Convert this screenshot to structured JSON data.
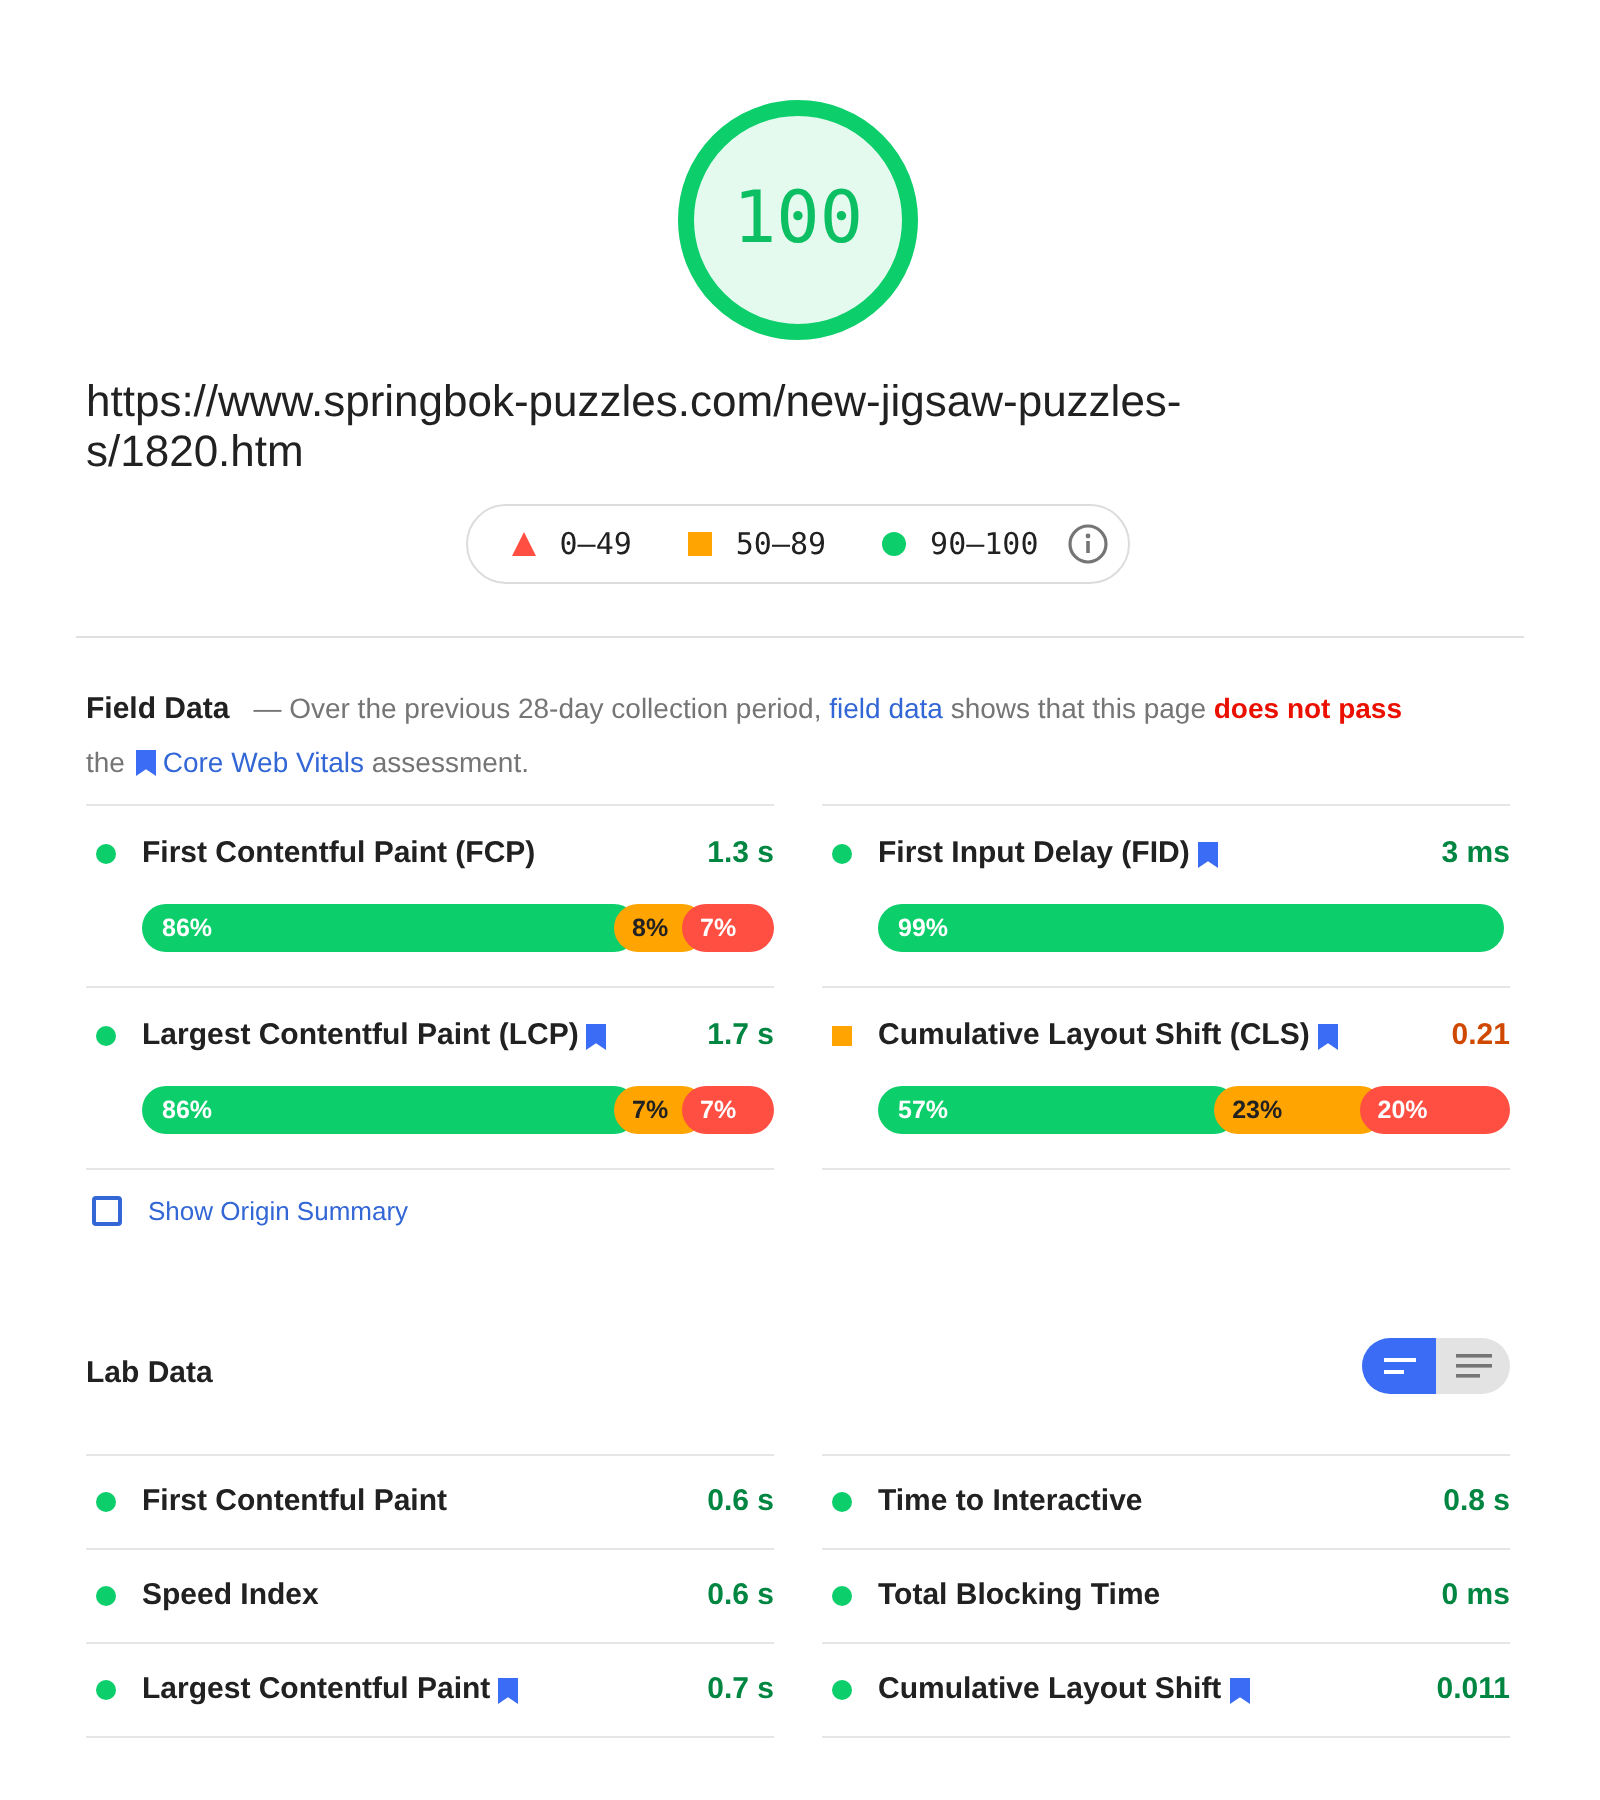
{
  "gauge": {
    "score": "100",
    "level": 1
  },
  "url": "https://www.springbok-puzzles.com/new-jigsaw-puzzles-s/1820.htm",
  "legend": [
    {
      "kind": "fail",
      "label": "0–49"
    },
    {
      "kind": "average",
      "label": "50–89"
    },
    {
      "kind": "pass",
      "label": "90–100"
    }
  ],
  "field_data": {
    "title": "Field Data",
    "description": [
      {
        "kind": "text",
        "text": "— Over the previous 28-day collection period,"
      },
      {
        "kind": "link",
        "text": "field data"
      },
      {
        "kind": "text",
        "text": "shows that this page"
      },
      {
        "kind": "alert",
        "text": "does not pass"
      },
      {
        "kind": "text",
        "text": "the"
      },
      {
        "kind": "cwv_link",
        "text": "Core Web Vitals"
      },
      {
        "kind": "text",
        "text": "assessment."
      }
    ],
    "metrics": [
      {
        "name": "First Contentful Paint (FCP)",
        "core_web_vital": false,
        "value": "1.3 s",
        "kind": "pass",
        "distribution": [
          {
            "kind": "pass",
            "label": "86%"
          },
          {
            "kind": "average",
            "label": "8%"
          },
          {
            "kind": "fail",
            "label": "7%"
          }
        ]
      },
      {
        "name": "First Input Delay (FID)",
        "core_web_vital": true,
        "value": "3 ms",
        "kind": "pass",
        "distribution": [
          {
            "kind": "pass",
            "label": "99%"
          }
        ]
      },
      {
        "name": "Largest Contentful Paint (LCP)",
        "core_web_vital": true,
        "value": "1.7 s",
        "kind": "pass",
        "distribution": [
          {
            "kind": "pass",
            "label": "86%"
          },
          {
            "kind": "average",
            "label": "7%"
          },
          {
            "kind": "fail",
            "label": "7%"
          }
        ]
      },
      {
        "name": "Cumulative Layout Shift (CLS)",
        "core_web_vital": true,
        "value": "0.21",
        "kind": "average",
        "distribution": [
          {
            "kind": "pass",
            "label": "57%"
          },
          {
            "kind": "average",
            "label": "23%"
          },
          {
            "kind": "fail",
            "label": "20%"
          }
        ]
      }
    ],
    "origin_summary": {
      "label": "Show Origin Summary",
      "checked": false
    }
  },
  "lab_data": {
    "title": "Lab Data",
    "view_toggle": [
      {
        "selected": true
      },
      {
        "selected": false
      }
    ],
    "metrics": [
      {
        "name": "First Contentful Paint",
        "core_web_vital": false,
        "value": "0.6 s",
        "kind": "pass"
      },
      {
        "name": "Time to Interactive",
        "core_web_vital": false,
        "value": "0.8 s",
        "kind": "pass"
      },
      {
        "name": "Speed Index",
        "core_web_vital": false,
        "value": "0.6 s",
        "kind": "pass"
      },
      {
        "name": "Total Blocking Time",
        "core_web_vital": false,
        "value": "0 ms",
        "kind": "pass"
      },
      {
        "name": "Largest Contentful Paint",
        "core_web_vital": true,
        "value": "0.7 s",
        "kind": "pass"
      },
      {
        "name": "Cumulative Layout Shift",
        "core_web_vital": true,
        "value": "0.011",
        "kind": "pass"
      }
    ]
  }
}
